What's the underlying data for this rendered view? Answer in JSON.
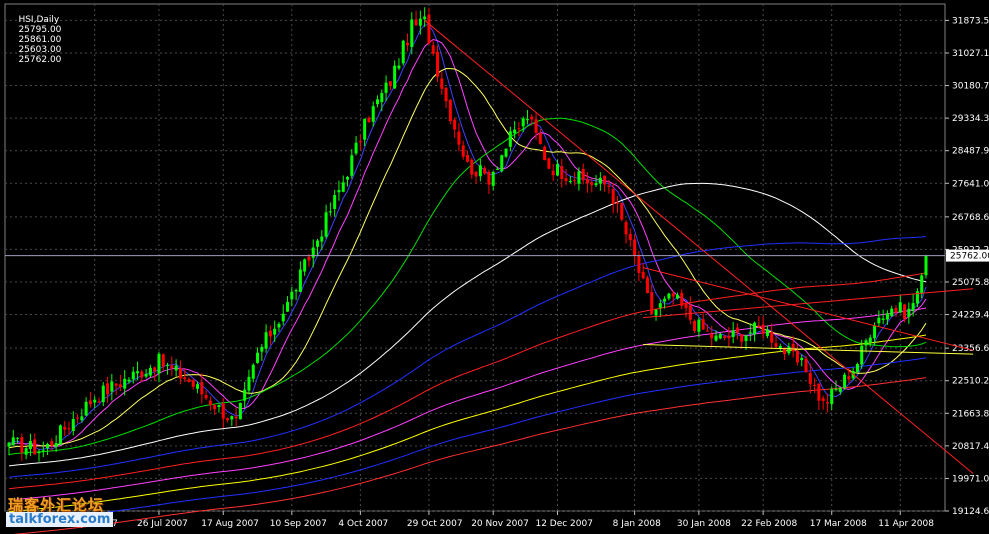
{
  "header": {
    "symbol": "HSI,Daily",
    "ohlc": [
      "25795.00",
      "25861.00",
      "25603.00",
      "25762.00"
    ]
  },
  "last_price": {
    "label": "25762.00",
    "value": 25762
  },
  "watermark": {
    "cn": "瑞客外汇论坛",
    "en": "talkforex.com"
  },
  "colors": {
    "background": "#000000",
    "grid": "#4a4a4a",
    "bull": "#00ff00",
    "bear": "#ff0000",
    "axis_text": "#ffffff",
    "cursor_box": "#ffffff"
  },
  "chart_data": {
    "type": "candlestick",
    "symbol": "HSI",
    "timeframe": "Daily",
    "ylim": [
      19124.6,
      32300
    ],
    "y_ticks": [
      "31873.50",
      "31027.10",
      "30180.70",
      "29334.30",
      "28487.90",
      "27641.05",
      "26768.65",
      "25922.25",
      "25075.85",
      "24229.45",
      "23356.60",
      "22510.20",
      "21663.80",
      "20817.40",
      "19971.00",
      "19124.60"
    ],
    "x_ticks": [
      "4 Jul 2007",
      "26 Jul 2007",
      "17 Aug 2007",
      "10 Sep 2007",
      "4 Oct 2007",
      "29 Oct 2007",
      "20 Nov 2007",
      "12 Dec 2007",
      "8 Jan 2008",
      "30 Jan 2008",
      "22 Feb 2008",
      "17 Mar 2008",
      "11 Apr 2008"
    ],
    "x_tick_index": [
      20,
      35,
      50,
      66,
      82,
      98,
      113,
      128,
      146,
      161,
      176,
      192,
      208
    ],
    "grid": true,
    "anchors": [
      [
        0,
        20900
      ],
      [
        8,
        20700
      ],
      [
        20,
        22100
      ],
      [
        28,
        22600
      ],
      [
        35,
        23000
      ],
      [
        41,
        22600
      ],
      [
        48,
        21900
      ],
      [
        53,
        21400
      ],
      [
        58,
        23200
      ],
      [
        65,
        24500
      ],
      [
        72,
        26200
      ],
      [
        78,
        27700
      ],
      [
        84,
        29400
      ],
      [
        89,
        30300
      ],
      [
        94,
        31700
      ],
      [
        97,
        31850
      ],
      [
        102,
        29800
      ],
      [
        107,
        28100
      ],
      [
        112,
        27800
      ],
      [
        117,
        28800
      ],
      [
        121,
        29400
      ],
      [
        126,
        28100
      ],
      [
        130,
        27900
      ],
      [
        134,
        27700
      ],
      [
        140,
        27600
      ],
      [
        146,
        25700
      ],
      [
        150,
        24300
      ],
      [
        155,
        24700
      ],
      [
        160,
        24000
      ],
      [
        165,
        23600
      ],
      [
        170,
        23700
      ],
      [
        176,
        23900
      ],
      [
        181,
        23300
      ],
      [
        186,
        22800
      ],
      [
        190,
        21900
      ],
      [
        194,
        22400
      ],
      [
        198,
        23000
      ],
      [
        202,
        24100
      ],
      [
        206,
        24400
      ],
      [
        210,
        24300
      ],
      [
        213,
        25100
      ],
      [
        214,
        25762
      ]
    ],
    "moving_averages": [
      {
        "period": 5,
        "color": "#4040ff"
      },
      {
        "period": 10,
        "color": "#ff40ff"
      },
      {
        "period": 20,
        "color": "#ffff60"
      },
      {
        "period": 50,
        "color": "#00dd00"
      },
      {
        "period": 100,
        "color": "#ffffff"
      },
      {
        "period": 150,
        "color": "#2030ff"
      },
      {
        "period": 200,
        "color": "#ff2020"
      },
      {
        "period": 250,
        "color": "#ff40ff"
      },
      {
        "period": 300,
        "color": "#ffff00"
      },
      {
        "period": 350,
        "color": "#2030ff"
      },
      {
        "period": 400,
        "color": "#ff3030"
      }
    ],
    "trendlines": [
      {
        "p1": [
          97,
          31873
        ],
        "p2": [
          225,
          20100
        ],
        "color": "#ff2020"
      },
      {
        "p1": [
          148,
          25450
        ],
        "p2": [
          225,
          23300
        ],
        "color": "#ff2020"
      },
      {
        "p1": [
          148,
          24150
        ],
        "p2": [
          225,
          24900
        ],
        "color": "#ff2020"
      },
      {
        "p1": [
          148,
          23450
        ],
        "p2": [
          225,
          23200
        ],
        "color": "#ffff40"
      }
    ],
    "horizontal_line": {
      "value": 25762,
      "color": "#a0a0c0"
    }
  }
}
